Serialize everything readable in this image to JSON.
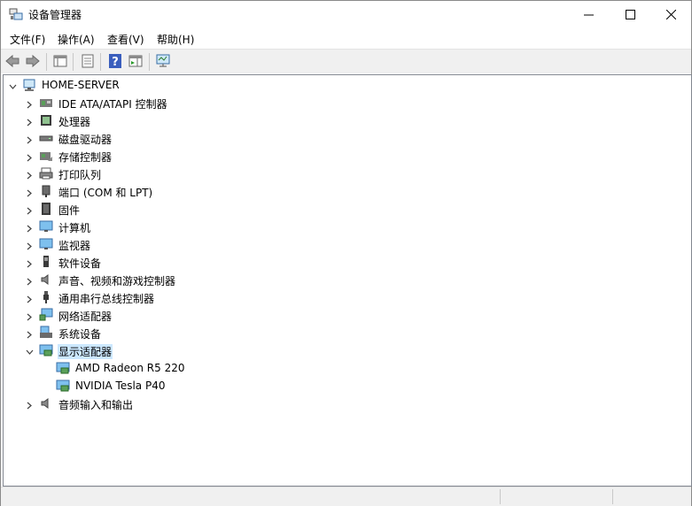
{
  "window": {
    "title": "设备管理器"
  },
  "menu": [
    "文件(F)",
    "操作(A)",
    "查看(V)",
    "帮助(H)"
  ],
  "toolbar": [
    {
      "name": "back-button-icon"
    },
    {
      "name": "forward-button-icon"
    },
    {
      "name": "show-hide-console-tree-icon"
    },
    {
      "name": "properties-icon"
    },
    {
      "name": "help-icon"
    },
    {
      "name": "action-pane-icon"
    },
    {
      "name": "scan-hardware-icon"
    }
  ],
  "tree": {
    "root": "HOME-SERVER",
    "categories": [
      {
        "label": "IDE ATA/ATAPI 控制器",
        "icon": "ide-controller-icon"
      },
      {
        "label": "处理器",
        "icon": "processor-icon"
      },
      {
        "label": "磁盘驱动器",
        "icon": "disk-drive-icon"
      },
      {
        "label": "存储控制器",
        "icon": "storage-controller-icon"
      },
      {
        "label": "打印队列",
        "icon": "print-queue-icon"
      },
      {
        "label": "端口 (COM 和 LPT)",
        "icon": "port-icon"
      },
      {
        "label": "固件",
        "icon": "firmware-icon"
      },
      {
        "label": "计算机",
        "icon": "computer-icon"
      },
      {
        "label": "监视器",
        "icon": "monitor-icon"
      },
      {
        "label": "软件设备",
        "icon": "software-device-icon"
      },
      {
        "label": "声音、视频和游戏控制器",
        "icon": "sound-icon"
      },
      {
        "label": "通用串行总线控制器",
        "icon": "usb-icon"
      },
      {
        "label": "网络适配器",
        "icon": "network-adapter-icon"
      },
      {
        "label": "系统设备",
        "icon": "system-device-icon"
      },
      {
        "label": "显示适配器",
        "icon": "display-adapter-icon",
        "expanded": true,
        "selected": true,
        "children": [
          "AMD Radeon R5 220",
          "NVIDIA Tesla P40"
        ]
      },
      {
        "label": "音频输入和输出",
        "icon": "audio-io-icon"
      }
    ]
  }
}
